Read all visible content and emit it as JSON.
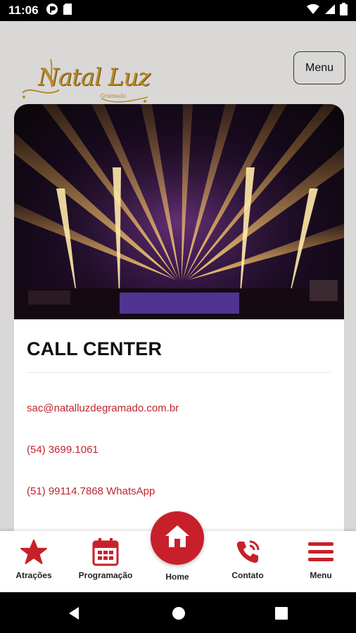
{
  "status_bar": {
    "time": "11:06",
    "icons": [
      "pocket-casts-icon",
      "sd-card-icon",
      "wifi-icon",
      "signal-icon",
      "battery-icon"
    ]
  },
  "header": {
    "logo_text": "Natal Luz",
    "logo_subtext": "Gramado",
    "menu_button_label": "Menu"
  },
  "card": {
    "title": "CALL CENTER",
    "email": "sac@natalluzdegramado.com.br",
    "phone": "(54) 3699.1061",
    "whatsapp": "(51) 99114.7868 WhatsApp"
  },
  "bottom_nav": {
    "items": [
      {
        "label": "Atrações",
        "icon": "star-icon"
      },
      {
        "label": "Programação",
        "icon": "calendar-icon"
      },
      {
        "label": "Home",
        "icon": "home-icon"
      },
      {
        "label": "Contato",
        "icon": "phone-call-icon"
      },
      {
        "label": "Menu",
        "icon": "hamburger-menu-icon"
      }
    ]
  },
  "colors": {
    "accent": "#c8202a",
    "background": "#d9d8d7",
    "logo_gold": "#b9892a"
  }
}
